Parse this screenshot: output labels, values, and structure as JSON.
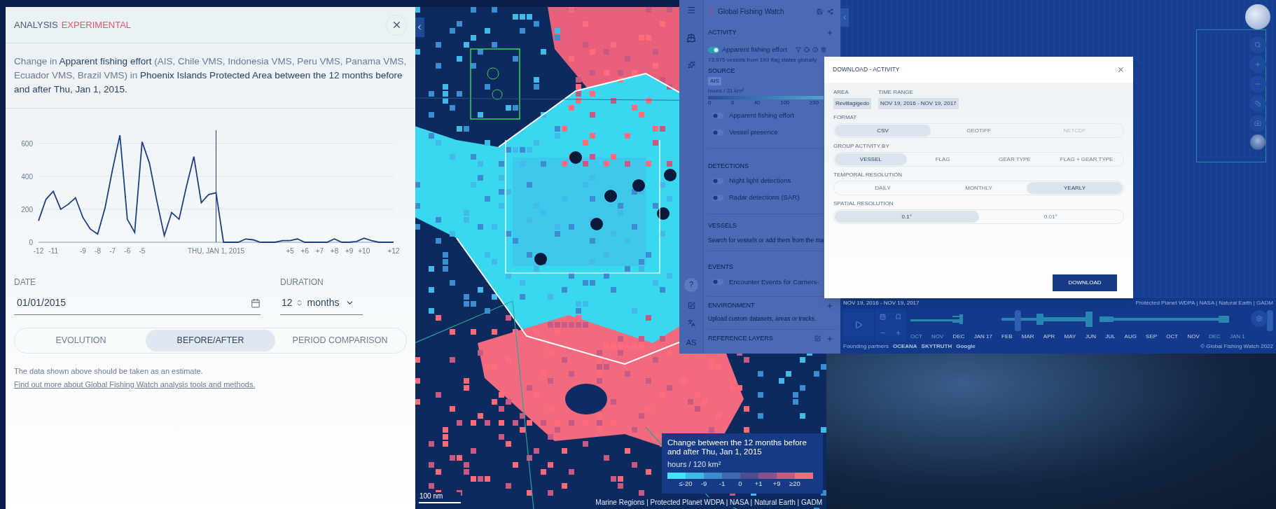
{
  "analysis_panel": {
    "title": "ANALYSIS",
    "badge": "EXPERIMENTAL",
    "description": "Change in **Apparent fishing effort** (AIS, Chile VMS, Indonesia VMS, Peru VMS, Panama VMS, Ecuador VMS, Brazil VMS) in **Phoenix Islands Protected Area between the 12 months before and after Thu, Jan 1, 2015.**",
    "chart_data": {
      "type": "line",
      "xlim": [
        -12,
        12
      ],
      "ylim": [
        0,
        680
      ],
      "x": [
        -12,
        -11.5,
        -11,
        -10.5,
        -10,
        -9.5,
        -9,
        -8.5,
        -8,
        -7.5,
        -7,
        -6.5,
        -6,
        -5.5,
        -5,
        -4.5,
        -4,
        -3.5,
        -3,
        -2.5,
        -2,
        -1.5,
        -1,
        -0.5,
        0,
        0.5,
        1,
        1.5,
        2,
        2.5,
        3,
        3.5,
        4,
        4.5,
        5,
        5.5,
        6,
        6.5,
        7,
        7.5,
        8,
        8.5,
        9,
        9.5,
        10,
        10.5,
        11,
        11.5,
        12
      ],
      "series": [
        {
          "color": "#1f3f80",
          "values": [
            130,
            260,
            310,
            200,
            230,
            270,
            150,
            80,
            50,
            210,
            440,
            650,
            140,
            60,
            610,
            480,
            250,
            40,
            180,
            140,
            340,
            520,
            240,
            290,
            300,
            0,
            0,
            0,
            20,
            15,
            0,
            0,
            0,
            10,
            10,
            20,
            0,
            0,
            0,
            0,
            20,
            0,
            0,
            5,
            25,
            10,
            0,
            0,
            0
          ]
        }
      ],
      "xticks": [
        {
          "value": -12,
          "label": "-12"
        },
        {
          "value": -11,
          "label": "-11"
        },
        {
          "value": -9,
          "label": "-9"
        },
        {
          "value": -8,
          "label": "-8"
        },
        {
          "value": -7,
          "label": "-7"
        },
        {
          "value": -6,
          "label": "-6"
        },
        {
          "value": -5,
          "label": "-5"
        },
        {
          "value": 0,
          "label": "THU, JAN 1, 2015"
        },
        {
          "value": 5,
          "label": "+5"
        },
        {
          "value": 6,
          "label": "+6"
        },
        {
          "value": 7,
          "label": "+7"
        },
        {
          "value": 8,
          "label": "+8"
        },
        {
          "value": 9,
          "label": "+9"
        },
        {
          "value": 10,
          "label": "+10"
        },
        {
          "value": 12,
          "label": "+12"
        }
      ],
      "yticks": [
        0,
        200,
        400,
        600
      ],
      "grid": true,
      "ref_lines": [
        {
          "axis": "x",
          "value": 0
        }
      ]
    },
    "date": {
      "label": "DATE",
      "value": "01/01/2015"
    },
    "duration": {
      "label": "DURATION",
      "value": "12",
      "unit": "months"
    },
    "modes": [
      {
        "label": "EVOLUTION",
        "selected": false
      },
      {
        "label": "BEFORE/AFTER",
        "selected": true
      },
      {
        "label": "PERIOD COMPARISON",
        "selected": false
      }
    ],
    "note": "The data shown above should be taken as an estimate.",
    "note_link": "Find out more about Global Fishing Watch analysis tools and methods."
  },
  "map": {
    "scale": "100 nm",
    "attribution": "Marine Regions | Protected Planet WDPA | NASA | Natural Earth | GADM",
    "legend": {
      "title": "Change between the 12 months before and after Thu, Jan 1, 2015",
      "unit": "hours / 120 km²",
      "steps": [
        {
          "color": "#3fe6f7"
        },
        {
          "color": "#41b9e9"
        },
        {
          "color": "#3d8bd0"
        },
        {
          "color": "#4068ad"
        },
        {
          "color": "#4c4e8e"
        },
        {
          "color": "#8b4f8b"
        },
        {
          "color": "#c85a80"
        },
        {
          "color": "#ff6b7b"
        }
      ],
      "labels": [
        "≤-20",
        "-9",
        "-1",
        "0",
        "+1",
        "+9",
        "≥20"
      ]
    }
  },
  "sidebar": {
    "brand": "Global Fishing Watch",
    "activity": {
      "title": "ACTIVITY",
      "layer": {
        "label": "Apparent fishing effort",
        "on": true
      },
      "summary": "73,975 vessels from 193 flag states globally",
      "source_label": "SOURCE",
      "source": "AIS",
      "unit": "hours / 31 km²",
      "scale_labels": [
        "0",
        "8",
        "40",
        "100",
        "≥30"
      ],
      "options": [
        {
          "label": "Apparent fishing effort",
          "on": false
        },
        {
          "label": "Vessel presence",
          "on": false
        }
      ]
    },
    "detections": {
      "title": "DETECTIONS",
      "layers": [
        {
          "label": "Night light detections",
          "on": false
        },
        {
          "label": "Radar detections (SAR)",
          "on": false
        }
      ]
    },
    "vessels": {
      "title": "VESSELS",
      "hint": "Search for vessels or add them from the ma"
    },
    "events": {
      "title": "EVENTS",
      "layers": [
        {
          "label": "Encounter Events for Carriers-",
          "on": false
        }
      ]
    },
    "environment": {
      "title": "ENVIRONMENT",
      "hint": "Upload custom datasets, areas or tracks."
    },
    "reference": {
      "title": "REFERENCE LAYERS"
    },
    "help": "?",
    "user": "AS"
  },
  "download_dialog": {
    "title": "DOWNLOAD - ACTIVITY",
    "area": {
      "label": "AREA",
      "value": "Revillagigedo"
    },
    "time_range": {
      "label": "TIME RANGE",
      "value": "NOV 19, 2016 - NOV 19, 2017"
    },
    "groups": [
      {
        "label": "FORMAT",
        "options": [
          {
            "label": "CSV",
            "selected": true,
            "disabled": false
          },
          {
            "label": "GEOTIFF",
            "selected": false,
            "disabled": false
          },
          {
            "label": "NETCDF",
            "selected": false,
            "disabled": true
          }
        ]
      },
      {
        "label": "GROUP ACTIVITY BY",
        "options": [
          {
            "label": "VESSEL",
            "selected": true,
            "disabled": false
          },
          {
            "label": "FLAG",
            "selected": false,
            "disabled": false
          },
          {
            "label": "GEAR TYPE",
            "selected": false,
            "disabled": false
          },
          {
            "label": "FLAG + GEAR TYPE",
            "selected": false,
            "disabled": false
          }
        ]
      },
      {
        "label": "TEMPORAL RESOLUTION",
        "options": [
          {
            "label": "DAILY",
            "selected": false,
            "disabled": false
          },
          {
            "label": "MONTHLY",
            "selected": false,
            "disabled": false
          },
          {
            "label": "YEARLY",
            "selected": true,
            "disabled": false
          }
        ]
      },
      {
        "label": "SPATIAL RESOLUTION",
        "options": [
          {
            "label": "0.1°",
            "selected": true,
            "disabled": false
          },
          {
            "label": "0.01°",
            "selected": false,
            "disabled": false
          }
        ]
      }
    ],
    "action": "DOWNLOAD"
  },
  "timeline": {
    "range": "NOV 19, 2016 - NOV 19, 2017",
    "attribution": "Protected Planet WDPA | NASA | Natural Earth | GADM",
    "months": [
      {
        "label": "OCT",
        "dim": true
      },
      {
        "label": "NOV",
        "dim": true
      },
      {
        "label": "DEC",
        "dim": false
      },
      {
        "label": "JAN 17",
        "dim": false
      },
      {
        "label": "FEB",
        "dim": false
      },
      {
        "label": "MAR",
        "dim": false
      },
      {
        "label": "APR",
        "dim": false
      },
      {
        "label": "MAY",
        "dim": false
      },
      {
        "label": "JUN",
        "dim": false
      },
      {
        "label": "JUL",
        "dim": false
      },
      {
        "label": "AUG",
        "dim": false
      },
      {
        "label": "SEP",
        "dim": false
      },
      {
        "label": "OCT",
        "dim": false
      },
      {
        "label": "NOV",
        "dim": false
      },
      {
        "label": "DEC",
        "dim": true
      },
      {
        "label": "JAN 1",
        "dim": true
      }
    ],
    "partners_label": "Founding partners",
    "partners": [
      "OCEANA",
      "SKYTRUTH",
      "Google"
    ],
    "copyright": "© Global Fishing Watch 2022"
  }
}
